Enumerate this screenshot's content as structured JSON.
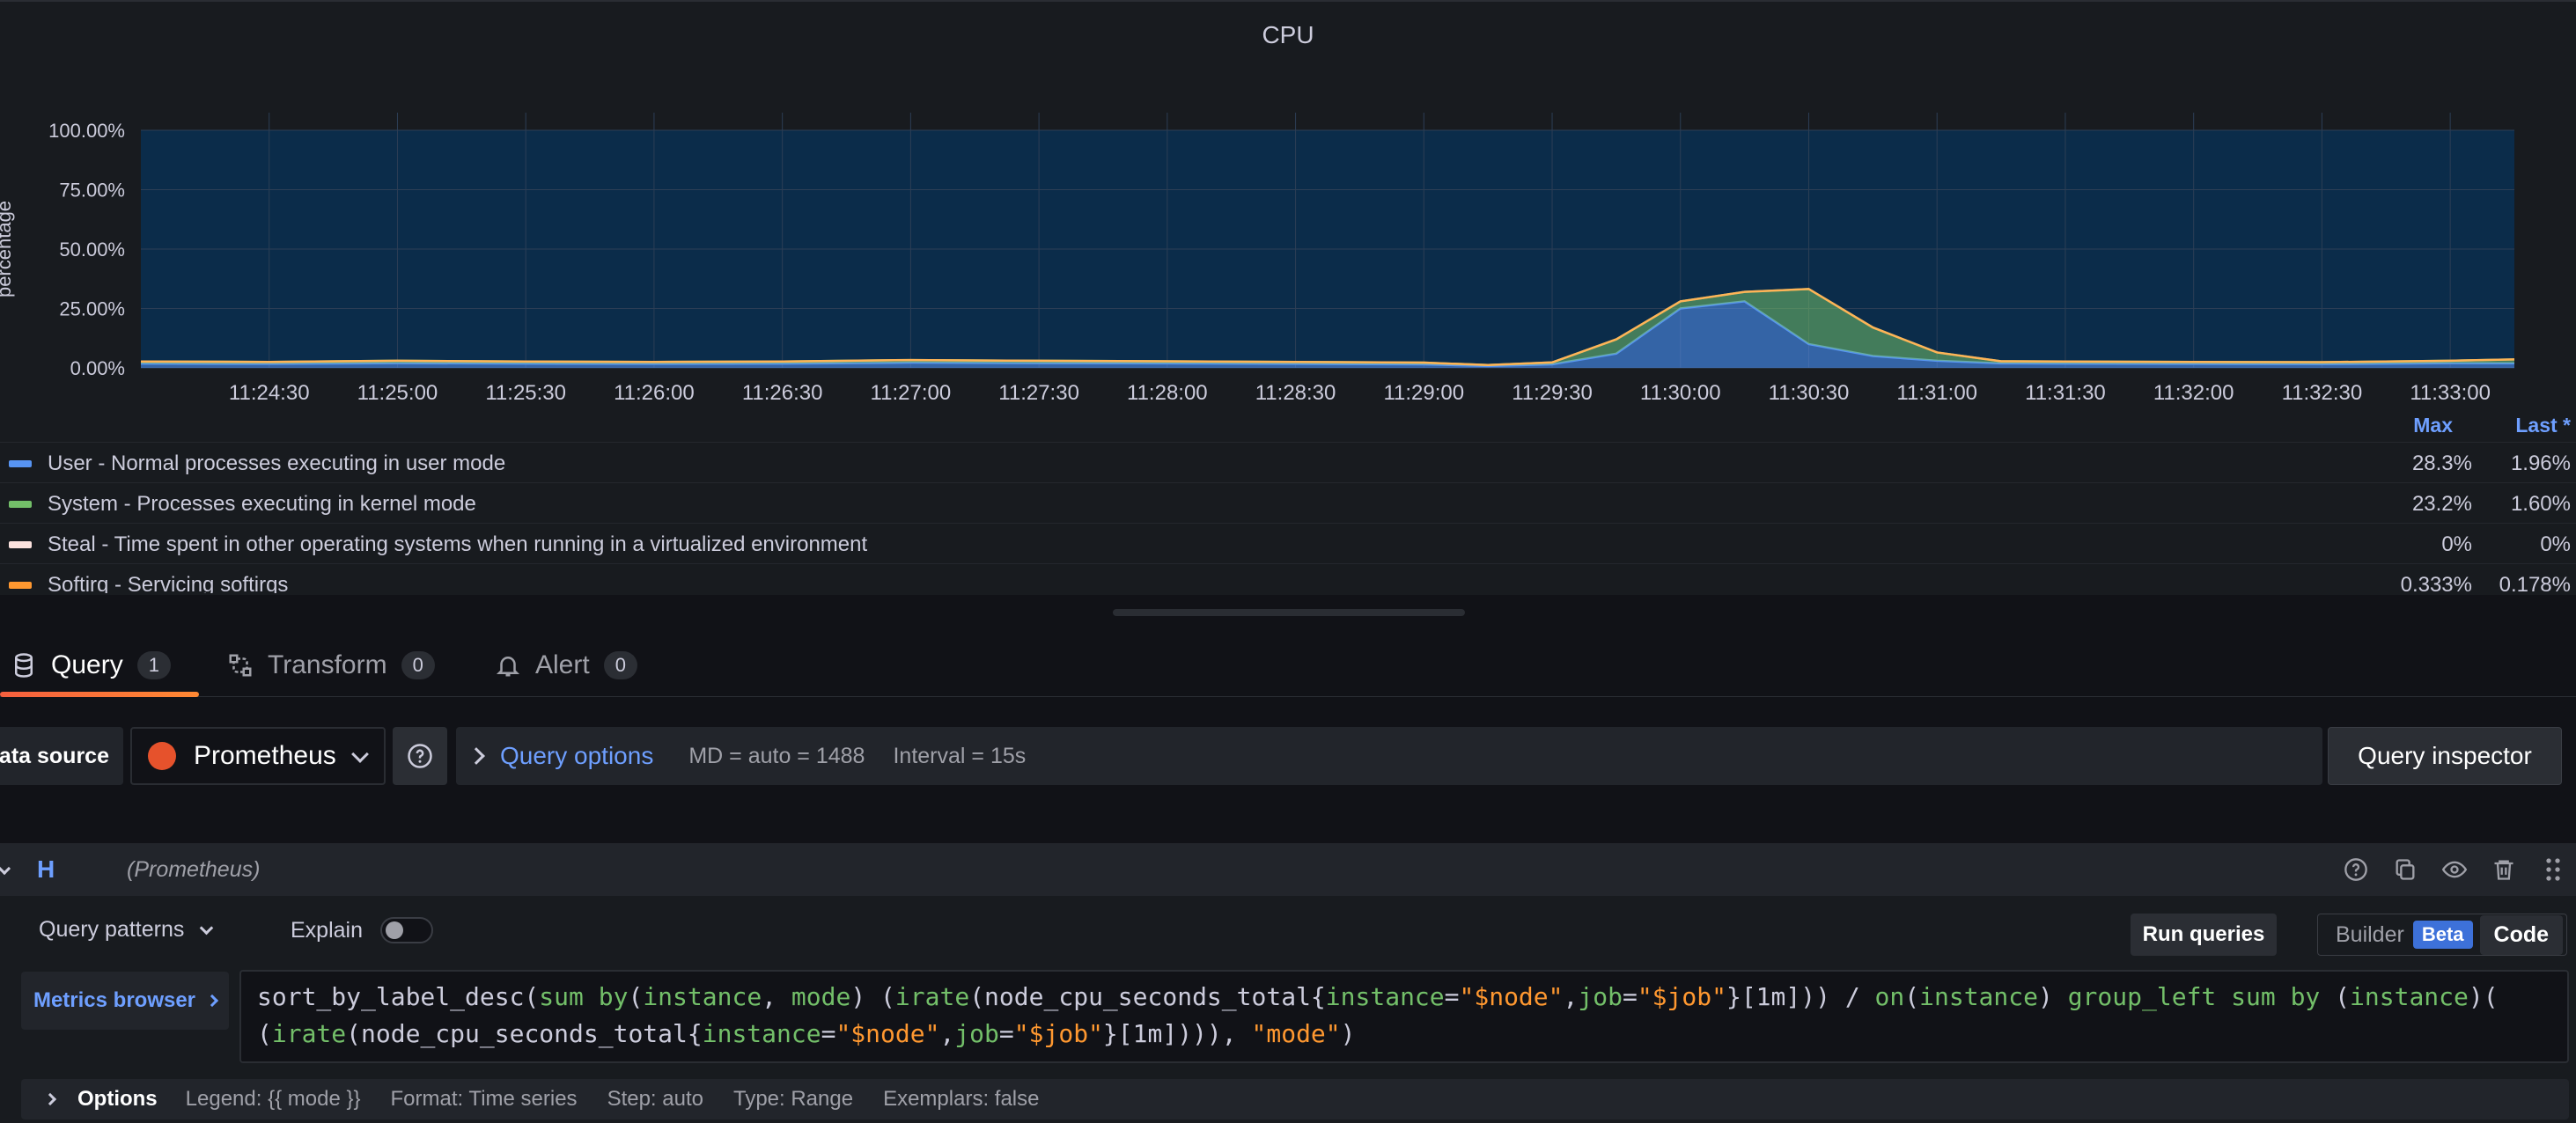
{
  "panel": {
    "title": "CPU"
  },
  "chart_data": {
    "type": "area",
    "title": "CPU",
    "ylabel": "percentage",
    "ylim": [
      0,
      100
    ],
    "y_ticks": [
      "100.00%",
      "75.00%",
      "50.00%",
      "25.00%",
      "0.00%"
    ],
    "x_ticks": [
      "11:24:30",
      "11:25:00",
      "11:25:30",
      "11:26:00",
      "11:26:30",
      "11:27:00",
      "11:27:30",
      "11:28:00",
      "11:28:30",
      "11:29:00",
      "11:29:30",
      "11:30:00",
      "11:30:30",
      "11:31:00",
      "11:31:30",
      "11:32:00",
      "11:32:30",
      "11:33:00"
    ],
    "x": [
      "11:24:00",
      "11:24:30",
      "11:25:00",
      "11:25:30",
      "11:26:00",
      "11:26:30",
      "11:27:00",
      "11:27:30",
      "11:28:00",
      "11:28:30",
      "11:29:00",
      "11:29:15",
      "11:29:30",
      "11:29:45",
      "11:30:00",
      "11:30:15",
      "11:30:30",
      "11:30:45",
      "11:31:00",
      "11:31:15",
      "11:31:30",
      "11:32:00",
      "11:32:30",
      "11:33:00",
      "11:33:15"
    ],
    "stacked": true,
    "series": [
      {
        "name": "User - Normal processes executing in user mode",
        "color": "#5794f2",
        "values": [
          1.8,
          1.7,
          2.0,
          1.8,
          1.7,
          1.8,
          2.2,
          2.0,
          1.9,
          1.7,
          1.5,
          0.8,
          1.5,
          6,
          25,
          28,
          10,
          5,
          3,
          1.9,
          1.8,
          1.7,
          1.6,
          2.0,
          1.96
        ]
      },
      {
        "name": "System - Processes executing in kernel mode",
        "color": "#73bf69",
        "values": [
          0.9,
          0.8,
          1.0,
          0.9,
          0.8,
          0.9,
          1.1,
          1.0,
          0.9,
          0.8,
          0.7,
          0.4,
          0.8,
          6,
          3,
          4,
          23.2,
          12,
          3.5,
          0.9,
          0.9,
          0.8,
          0.8,
          1.0,
          1.6
        ]
      },
      {
        "name": "Steal - Time spent in other operating systems when running in a virtualized environment",
        "color": "#ffb357",
        "values": [
          0,
          0,
          0,
          0,
          0,
          0,
          0,
          0,
          0,
          0,
          0,
          0,
          0,
          0,
          0,
          0,
          0,
          0,
          0,
          0,
          0,
          0,
          0,
          0,
          0
        ]
      }
    ],
    "idle_color": "#0b2c4a",
    "grid": true
  },
  "legend": {
    "max_header": "Max",
    "last_header": "Last *",
    "rows": [
      {
        "label": "User - Normal processes executing in user mode",
        "color": "#5794f2",
        "max": "28.3%",
        "last": "1.96%"
      },
      {
        "label": "System - Processes executing in kernel mode",
        "color": "#73bf69",
        "max": "23.2%",
        "last": "1.60%"
      },
      {
        "label": "Steal - Time spent in other operating systems when running in a virtualized environment",
        "color": "#fce2de",
        "max": "0%",
        "last": "0%"
      },
      {
        "label": "Softirq - Servicing softirqs",
        "color": "#ff9830",
        "max": "0.333%",
        "last": "0.178%"
      }
    ]
  },
  "tabs": [
    {
      "label": "Query",
      "count": "1",
      "icon": "database-icon"
    },
    {
      "label": "Transform",
      "count": "0",
      "icon": "transform-icon"
    },
    {
      "label": "Alert",
      "count": "0",
      "icon": "bell-icon"
    }
  ],
  "datasource": {
    "label": "Data source",
    "name": "Prometheus",
    "query_options_label": "Query options",
    "md": "MD = auto = 1488",
    "interval": "Interval = 15s",
    "inspector_label": "Query inspector"
  },
  "query": {
    "ref_id": "H",
    "ds_name": "(Prometheus)",
    "patterns_label": "Query patterns",
    "explain_label": "Explain",
    "run_label": "Run queries",
    "builder_label": "Builder",
    "beta_label": "Beta",
    "code_label": "Code",
    "metrics_browser_label": "Metrics browser",
    "expr_line1": "sort_by_label_desc(sum by(instance, mode) (irate(node_cpu_seconds_total{instance=\"$node\",job=\"$job\"}[1m])) / on(instance) group_left sum by (instance)(",
    "expr_line2": "(irate(node_cpu_seconds_total{instance=\"$node\",job=\"$job\"}[1m]))), \"mode\")",
    "options": {
      "title": "Options",
      "legend": "Legend: {{ mode }}",
      "format": "Format: Time series",
      "step": "Step: auto",
      "type": "Type: Range",
      "exemplars": "Exemplars: false"
    }
  }
}
